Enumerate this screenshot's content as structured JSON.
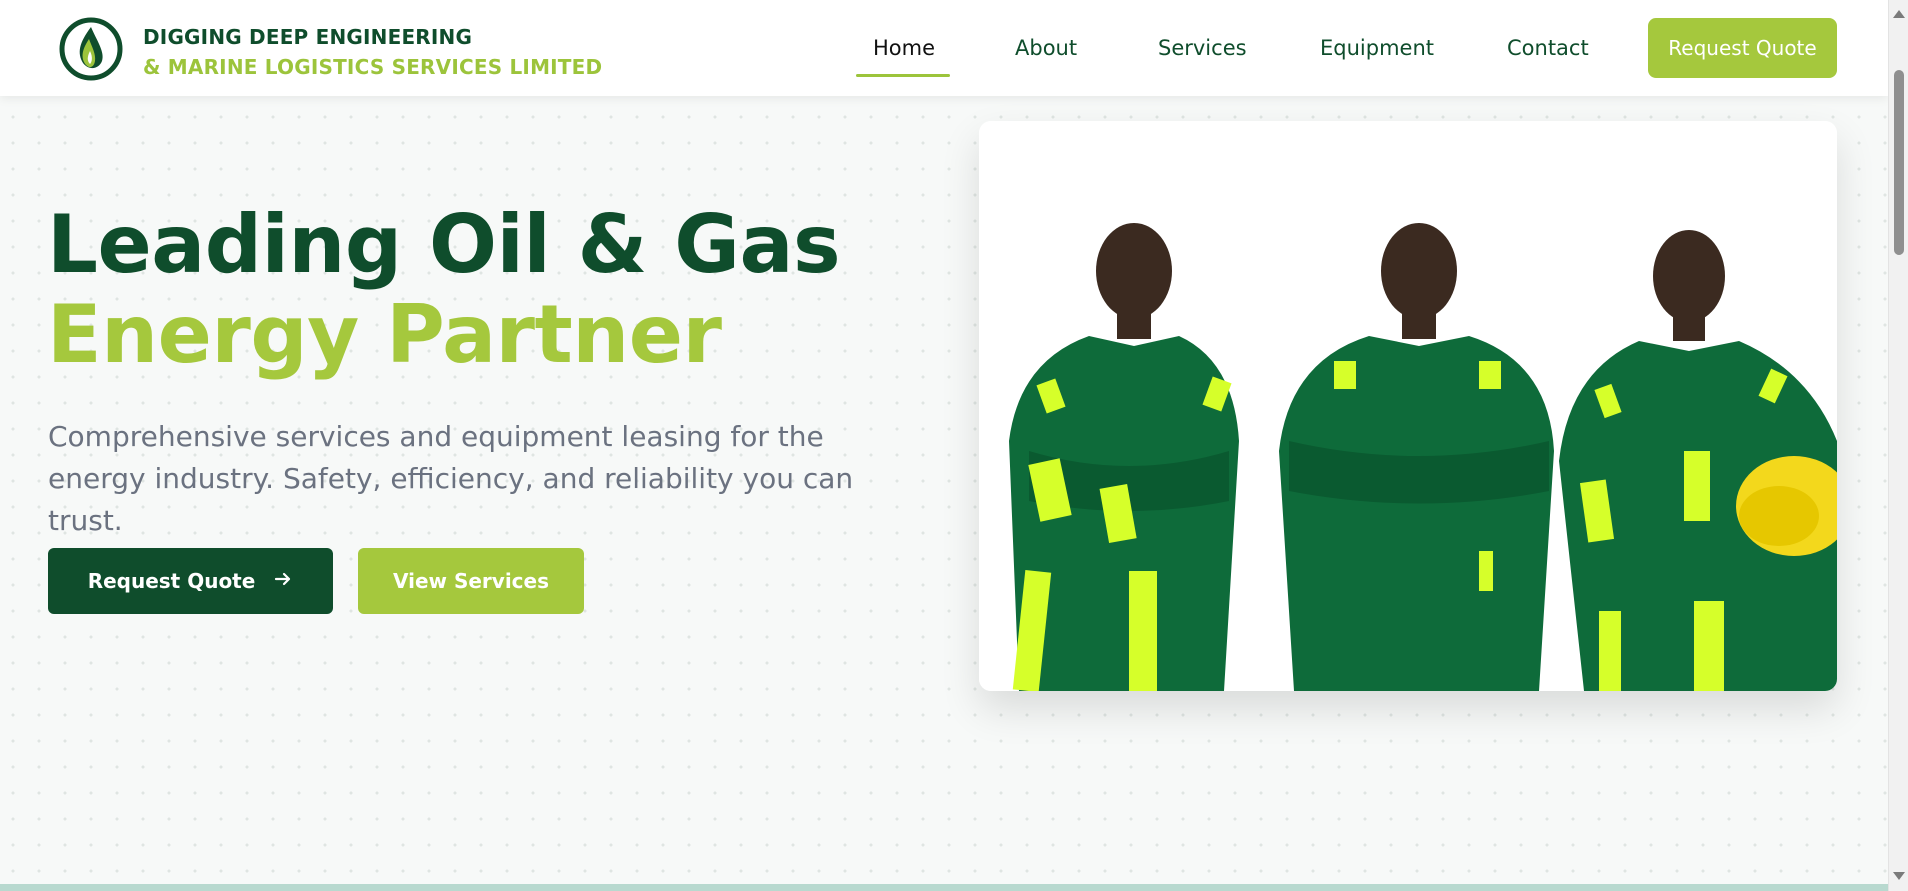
{
  "brand": {
    "line1": "DIGGING DEEP ENGINEERING",
    "line2": "& MARINE LOGISTICS SERVICES LIMITED",
    "logo_icon": "flame-drop-logo-icon"
  },
  "nav": {
    "items": [
      {
        "label": "Home",
        "active": true
      },
      {
        "label": "About",
        "active": false
      },
      {
        "label": "Services",
        "active": false
      },
      {
        "label": "Equipment",
        "active": false
      },
      {
        "label": "Contact",
        "active": false
      }
    ],
    "cta_label": "Request Quote"
  },
  "hero": {
    "title_line1": "Leading Oil & Gas",
    "title_line2": "Energy Partner",
    "description": "Comprehensive services and equipment leasing for the energy industry. Safety, efficiency, and reliability you can trust.",
    "primary_button": "Request Quote",
    "primary_button_icon": "arrow-right-icon",
    "secondary_button": "View Services",
    "image_alt": "Three workers in green coveralls with reflective stripes"
  },
  "colors": {
    "dark_green": "#0f4d2c",
    "lime": "#a5c83d",
    "text_grey": "#6b7280"
  }
}
